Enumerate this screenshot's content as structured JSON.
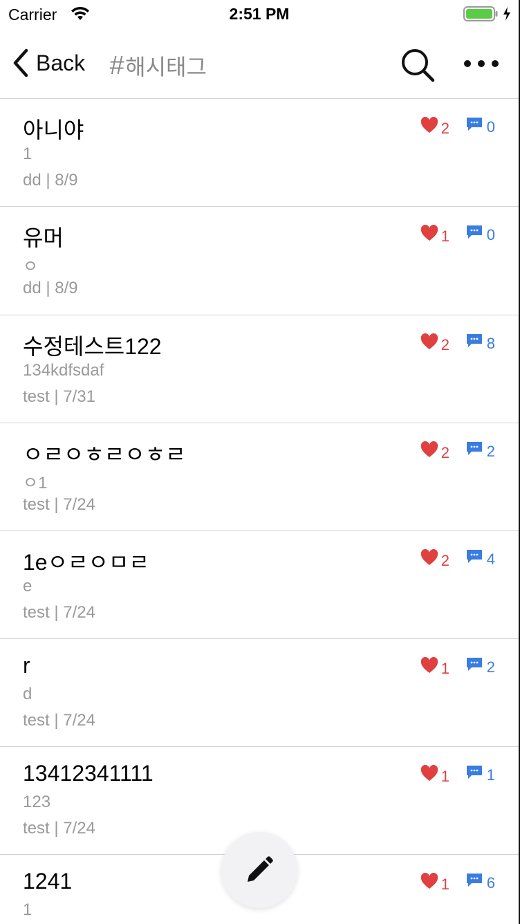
{
  "status_bar": {
    "carrier": "Carrier",
    "time": "2:51 PM",
    "wifi_icon": "wifi-icon",
    "battery_icon": "battery-charging-icon"
  },
  "nav": {
    "back_label": "Back",
    "hashtag_symbol": "#",
    "title": "해시태그",
    "search_icon": "search-icon",
    "more_icon": "more-horizontal-icon"
  },
  "colors": {
    "like": "#e04040",
    "comment": "#3a7de0",
    "muted": "#9a9a9a"
  },
  "posts": [
    {
      "title": "아니야",
      "body": "1",
      "meta": "dd | 8/9",
      "likes": "2",
      "comments": "0"
    },
    {
      "title": "유머",
      "body": "ㅇ",
      "meta": "dd | 8/9",
      "likes": "1",
      "comments": "0"
    },
    {
      "title": "수정테스트122",
      "body": "134kdfsdaf",
      "meta": "test | 7/31",
      "likes": "2",
      "comments": "8"
    },
    {
      "title": "ㅇㄹㅇㅎㄹㅇㅎㄹ",
      "body": "ㅇ1",
      "meta": "test | 7/24",
      "likes": "2",
      "comments": "2"
    },
    {
      "title": "1eㅇㄹㅇㅁㄹ",
      "body": "e",
      "meta": "test | 7/24",
      "likes": "2",
      "comments": "4"
    },
    {
      "title": "r",
      "body": "d",
      "meta": "test | 7/24",
      "likes": "1",
      "comments": "2"
    },
    {
      "title": "13412341111",
      "body": "123",
      "meta": "test | 7/24",
      "likes": "1",
      "comments": "1"
    },
    {
      "title": "1241",
      "body": "1",
      "meta": "",
      "likes": "1",
      "comments": "6"
    }
  ],
  "fab": {
    "icon": "pencil-icon"
  }
}
